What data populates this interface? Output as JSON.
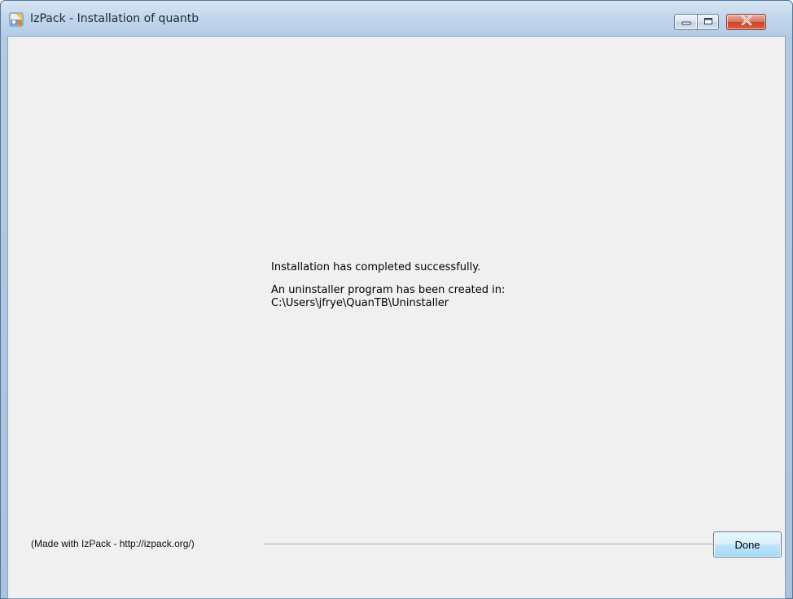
{
  "window": {
    "title": "IzPack - Installation of quantb",
    "controls": {
      "minimize_icon": "minimize-icon",
      "maximize_icon": "maximize-icon",
      "close_icon": "close-icon"
    }
  },
  "panel": {
    "completed_message": "Installation has completed successfully.",
    "uninstaller_message": "An uninstaller program has been created in:",
    "uninstaller_path": "C:\\Users\\jfrye\\QuanTB\\Uninstaller"
  },
  "footer": {
    "credit": "(Made with IzPack - http://izpack.org/)",
    "done_label": "Done"
  },
  "colors": {
    "title_bar": "#c1d6ec",
    "client_background": "#f0f0f0",
    "close_button": "#c7452b",
    "done_button": "#bee6fd"
  }
}
